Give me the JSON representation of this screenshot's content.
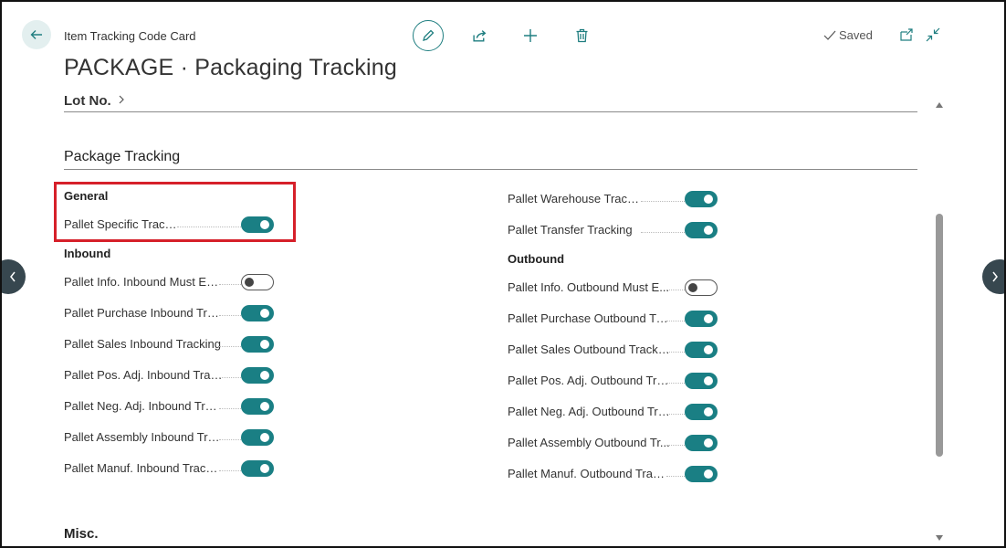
{
  "header": {
    "breadcrumb": "Item Tracking Code Card",
    "title": "PACKAGE · Packaging Tracking",
    "saved_label": "Saved"
  },
  "sections": {
    "lot_label": "Lot No.",
    "package_tracking_title": "Package Tracking",
    "misc_title": "Misc."
  },
  "general": {
    "title": "General",
    "fields": [
      {
        "label": "Pallet Specific Tracking",
        "value": true
      }
    ]
  },
  "inbound": {
    "title": "Inbound",
    "fields": [
      {
        "label": "Pallet Info. Inbound Must Exist",
        "value": false
      },
      {
        "label": "Pallet Purchase Inbound Trac...",
        "value": true
      },
      {
        "label": "Pallet Sales Inbound Tracking",
        "value": true
      },
      {
        "label": "Pallet Pos. Adj. Inbound Track...",
        "value": true
      },
      {
        "label": "Pallet Neg. Adj. Inbound Trac...",
        "value": true
      },
      {
        "label": "Pallet Assembly Inbound Trac...",
        "value": true
      },
      {
        "label": "Pallet Manuf. Inbound Tracking",
        "value": true
      }
    ]
  },
  "right_top": {
    "fields": [
      {
        "label": "Pallet Warehouse Tracking",
        "value": true
      },
      {
        "label": "Pallet Transfer Tracking",
        "value": true
      }
    ]
  },
  "outbound": {
    "title": "Outbound",
    "fields": [
      {
        "label": "Pallet Info. Outbound Must E...",
        "value": false
      },
      {
        "label": "Pallet Purchase Outbound Tra...",
        "value": true
      },
      {
        "label": "Pallet Sales Outbound Tracking",
        "value": true
      },
      {
        "label": "Pallet Pos. Adj. Outbound Tra...",
        "value": true
      },
      {
        "label": "Pallet Neg. Adj. Outbound Tra...",
        "value": true
      },
      {
        "label": "Pallet Assembly Outbound Tr...",
        "value": true
      },
      {
        "label": "Pallet Manuf. Outbound Track...",
        "value": true
      }
    ]
  },
  "colors": {
    "accent": "#1a7f84",
    "highlight": "#d6202a"
  }
}
